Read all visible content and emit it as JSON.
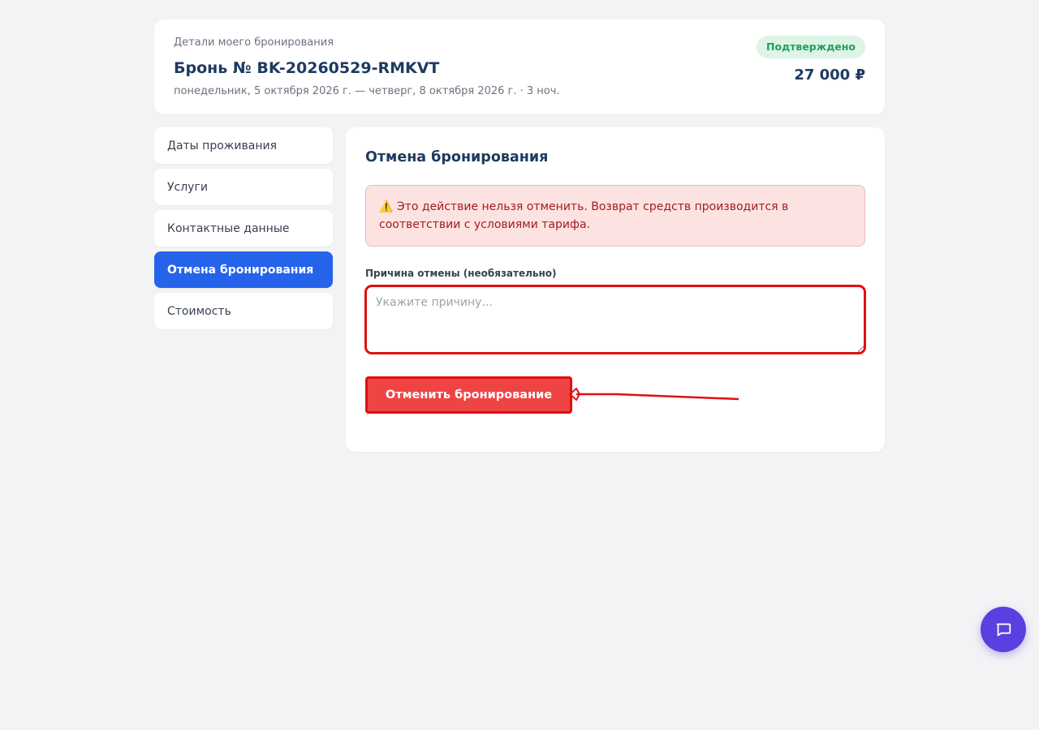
{
  "header": {
    "subtitle": "Детали моего бронирования",
    "title": "Бронь № BK-20260529-RMKVT",
    "dates": "понедельник, 5 октября 2026 г. — четверг, 8 октября 2026 г. · 3 ноч.",
    "status": "Подтверждено",
    "price": "27 000 ₽"
  },
  "sidebar": {
    "items": [
      {
        "label": "Даты проживания"
      },
      {
        "label": "Услуги"
      },
      {
        "label": "Контактные данные"
      },
      {
        "label": "Отмена бронирования"
      },
      {
        "label": "Стоимость"
      }
    ],
    "active": "Отмена бронирования"
  },
  "main": {
    "title": "Отмена бронирования",
    "alert": "⚠️ Это действие нельзя отменить. Возврат средств производится в соответствии с условиями тарифа.",
    "reason_label": "Причина отмены (необязательно)",
    "reason_placeholder": "Укажите причину...",
    "cancel_button": "Отменить бронирование"
  },
  "colors": {
    "accent": "#2563eb",
    "danger": "#ef4444",
    "badge_bg": "#dcf5e7",
    "badge_text": "#22a05b",
    "fab": "#5b3fe0",
    "annotation": "#e01010"
  },
  "icons": {
    "chat_button": "chat-bubble-icon",
    "annotation_arrow": "arrow-left-icon"
  }
}
